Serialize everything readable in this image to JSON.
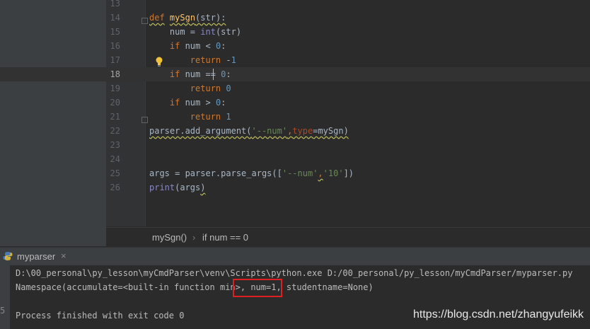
{
  "editor": {
    "current_line": "18",
    "lines": [
      {
        "n": "13",
        "segments": []
      },
      {
        "n": "14",
        "segments": [
          {
            "t": "def",
            "c": "kw squig"
          },
          {
            "t": " ",
            "c": ""
          },
          {
            "t": "mySgn",
            "c": "fn squig"
          },
          {
            "t": "(str):",
            "c": "squig"
          }
        ]
      },
      {
        "n": "15",
        "segments": [
          {
            "t": "    num = ",
            "c": ""
          },
          {
            "t": "int",
            "c": "bi"
          },
          {
            "t": "(str)",
            "c": ""
          }
        ]
      },
      {
        "n": "16",
        "segments": [
          {
            "t": "    ",
            "c": ""
          },
          {
            "t": "if",
            "c": "kw"
          },
          {
            "t": " num < ",
            "c": ""
          },
          {
            "t": "0",
            "c": "num"
          },
          {
            "t": ":",
            "c": ""
          }
        ]
      },
      {
        "n": "17",
        "segments": [
          {
            "t": "        ",
            "c": ""
          },
          {
            "t": "return",
            "c": "kw"
          },
          {
            "t": " -",
            "c": ""
          },
          {
            "t": "1",
            "c": "num"
          }
        ]
      },
      {
        "n": "18",
        "segments": [
          {
            "t": "    ",
            "c": ""
          },
          {
            "t": "if",
            "c": "kw"
          },
          {
            "t": " num == ",
            "c": ""
          },
          {
            "t": "0",
            "c": "num"
          },
          {
            "t": ":",
            "c": ""
          }
        ]
      },
      {
        "n": "19",
        "segments": [
          {
            "t": "        ",
            "c": ""
          },
          {
            "t": "return",
            "c": "kw"
          },
          {
            "t": " ",
            "c": ""
          },
          {
            "t": "0",
            "c": "num"
          }
        ]
      },
      {
        "n": "20",
        "segments": [
          {
            "t": "    ",
            "c": ""
          },
          {
            "t": "if",
            "c": "kw"
          },
          {
            "t": " num > ",
            "c": ""
          },
          {
            "t": "0",
            "c": "num"
          },
          {
            "t": ":",
            "c": ""
          }
        ]
      },
      {
        "n": "21",
        "segments": [
          {
            "t": "        ",
            "c": ""
          },
          {
            "t": "return",
            "c": "kw"
          },
          {
            "t": " ",
            "c": ""
          },
          {
            "t": "1",
            "c": "num"
          }
        ]
      },
      {
        "n": "22",
        "segments": [
          {
            "t": "parser.add_argument(",
            "c": "squig"
          },
          {
            "t": "'--num'",
            "c": "str squig"
          },
          {
            "t": ",",
            "c": "kw squig"
          },
          {
            "t": "type",
            "c": "param squig"
          },
          {
            "t": "=mySgn)",
            "c": "squig"
          }
        ]
      },
      {
        "n": "23",
        "segments": []
      },
      {
        "n": "24",
        "segments": []
      },
      {
        "n": "25",
        "segments": [
          {
            "t": "args = parser.parse_args([",
            "c": ""
          },
          {
            "t": "'--num'",
            "c": "str"
          },
          {
            "t": ",",
            "c": "kw squig"
          },
          {
            "t": "'10'",
            "c": "str"
          },
          {
            "t": "])",
            "c": ""
          }
        ]
      },
      {
        "n": "26",
        "segments": [
          {
            "t": "print",
            "c": "bi"
          },
          {
            "t": "(args",
            "c": ""
          },
          {
            "t": ")",
            "c": "squig"
          }
        ]
      }
    ]
  },
  "breadcrumb": {
    "item1": "mySgn()",
    "separator": "›",
    "item2": "if num == 0"
  },
  "run_tab": {
    "label": "myparser",
    "close": "×"
  },
  "console": {
    "lines": [
      "D:\\00_personal\\py_lesson\\myCmdParser\\venv\\Scripts\\python.exe D:/00_personal/py_lesson/myCmdParser/myparser.py",
      "Namespace(accumulate=<built-in function min>, num=1, studentname=None)",
      "",
      "Process finished with exit code 0"
    ]
  },
  "watermark": "https://blog.csdn.net/zhangyufeikk",
  "colors": {
    "background": "#2b2b2b",
    "keyword": "#cc7832",
    "function": "#ffc66d",
    "number": "#6897bb",
    "string": "#6a8759",
    "highlight_box": "#e02020"
  },
  "icons": [
    "python-icon",
    "lightbulb-icon",
    "fold-icon",
    "close-icon"
  ]
}
